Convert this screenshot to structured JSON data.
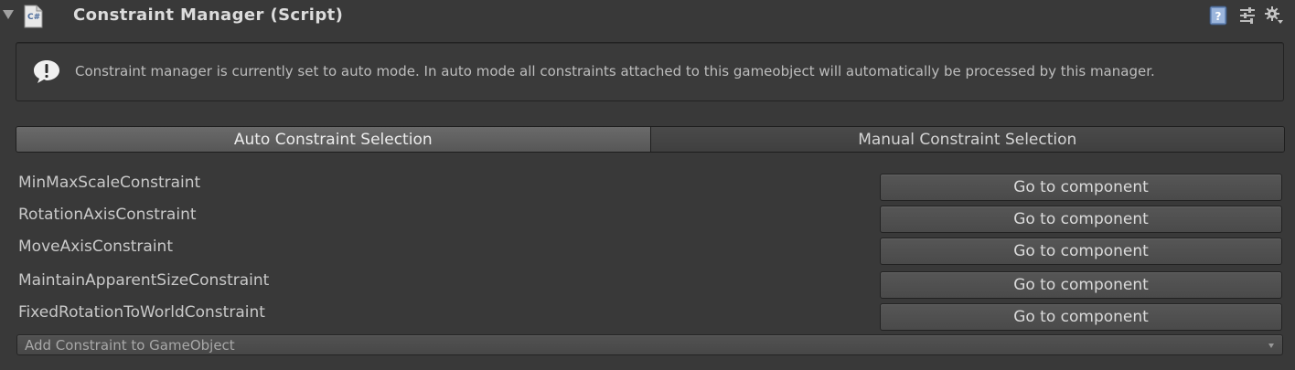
{
  "header": {
    "title": "Constraint Manager (Script)",
    "script_icon_label": "C#"
  },
  "helpbox": {
    "text": "Constraint manager is currently set to auto mode. In auto mode all constraints attached to this gameobject will automatically be processed by this manager."
  },
  "mode_toolbar": {
    "tabs": [
      {
        "label": "Auto Constraint Selection",
        "selected": true
      },
      {
        "label": "Manual Constraint Selection",
        "selected": false
      }
    ]
  },
  "constraints": [
    {
      "name": "MinMaxScaleConstraint",
      "button": "Go to component"
    },
    {
      "name": "RotationAxisConstraint",
      "button": "Go to component"
    },
    {
      "name": "MoveAxisConstraint",
      "button": "Go to component"
    },
    {
      "name": "MaintainApparentSizeConstraint",
      "button": "Go to component"
    },
    {
      "name": "FixedRotationToWorldConstraint",
      "button": "Go to component"
    }
  ],
  "add_constraint": {
    "selected": "Add Constraint to GameObject"
  },
  "colors": {
    "background": "#393939",
    "active_tab": "#606060",
    "button": "#505050"
  }
}
